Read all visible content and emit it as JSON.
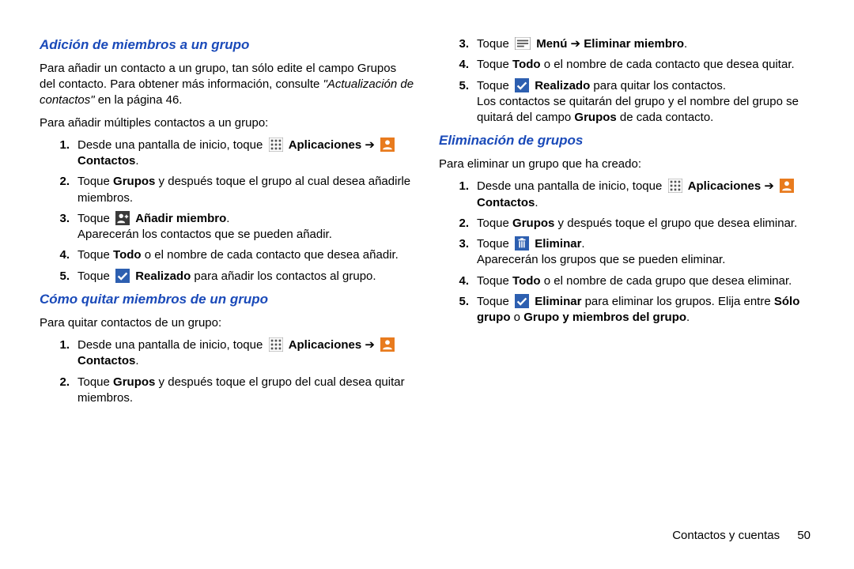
{
  "left": {
    "h1": "Adición de miembros a un grupo",
    "intro1": "Para añadir un contacto a un grupo, tan sólo edite el campo Grupos del contacto. Para obtener más información, consulte ",
    "intro1_link": "\"Actualización de contactos\"",
    "intro1_after": " en la página 46.",
    "intro2": "Para añadir múltiples contactos a un grupo:",
    "s1_1_pre": "Desde una pantalla de inicio, toque ",
    "s1_1_apps": "Aplicaciones",
    "s1_1_arrow": " ➔ ",
    "s1_1_contactos": "Contactos",
    "s1_1_period": ".",
    "s1_2_pre": "Toque ",
    "s1_2_grupos": "Grupos",
    "s1_2_post": " y después toque el grupo al cual desea añadirle miembros.",
    "s1_3_pre": "Toque ",
    "s1_3_bold": "Añadir miembro",
    "s1_3_period": ".",
    "s1_3_line2": "Aparecerán los contactos que se pueden añadir.",
    "s1_4_pre": "Toque ",
    "s1_4_todo": "Todo",
    "s1_4_post": " o el nombre de cada contacto que desea añadir.",
    "s1_5_pre": "Toque ",
    "s1_5_bold": "Realizado",
    "s1_5_post": " para añadir los contactos al grupo.",
    "h2": "Cómo quitar miembros de un grupo",
    "remove_intro": "Para quitar contactos de un grupo:",
    "s2_1_pre": "Desde una pantalla de inicio, toque ",
    "s2_1_apps": "Aplicaciones",
    "s2_1_arrow": " ➔ ",
    "s2_1_contactos": "Contactos",
    "s2_1_period": ".",
    "s2_2_pre": "Toque ",
    "s2_2_grupos": "Grupos",
    "s2_2_post": " y después toque el grupo del cual desea quitar miembros."
  },
  "right": {
    "s2_3_pre": "Toque ",
    "s2_3_menu": "Menú",
    "s2_3_arrow": " ➔ ",
    "s2_3_elim": "Eliminar miembro",
    "s2_3_period": ".",
    "s2_4_pre": "Toque ",
    "s2_4_todo": "Todo",
    "s2_4_post": " o el nombre de cada contacto que desea quitar.",
    "s2_5_pre": "Toque ",
    "s2_5_bold": "Realizado",
    "s2_5_post": " para quitar los contactos.",
    "s2_5_line2a": "Los contactos se quitarán del grupo y el nombre del grupo se quitará del campo ",
    "s2_5_line2_bold": "Grupos",
    "s2_5_line2b": " de cada contacto.",
    "h3": "Eliminación de grupos",
    "del_intro": "Para eliminar un grupo que ha creado:",
    "s3_1_pre": "Desde una pantalla de inicio, toque ",
    "s3_1_apps": "Aplicaciones",
    "s3_1_arrow": " ➔ ",
    "s3_1_contactos": "Contactos",
    "s3_1_period": ".",
    "s3_2_pre": "Toque ",
    "s3_2_grupos": "Grupos",
    "s3_2_post": " y después toque el grupo que desea eliminar.",
    "s3_3_pre": "Toque ",
    "s3_3_bold": "Eliminar",
    "s3_3_period": ".",
    "s3_3_line2": "Aparecerán los grupos que se pueden eliminar.",
    "s3_4_pre": "Toque ",
    "s3_4_todo": "Todo",
    "s3_4_post": " o el nombre de cada grupo que desea eliminar.",
    "s3_5_pre": "Toque ",
    "s3_5_bold": "Eliminar",
    "s3_5_post": " para eliminar los grupos. Elija entre ",
    "s3_5_opt1": "Sólo grupo",
    "s3_5_or": " o ",
    "s3_5_opt2": "Grupo y miembros del grupo",
    "s3_5_period": "."
  },
  "footer": {
    "section": "Contactos y cuentas",
    "page": "50"
  },
  "nums": {
    "n1": "1.",
    "n2": "2.",
    "n3": "3.",
    "n4": "4.",
    "n5": "5."
  }
}
